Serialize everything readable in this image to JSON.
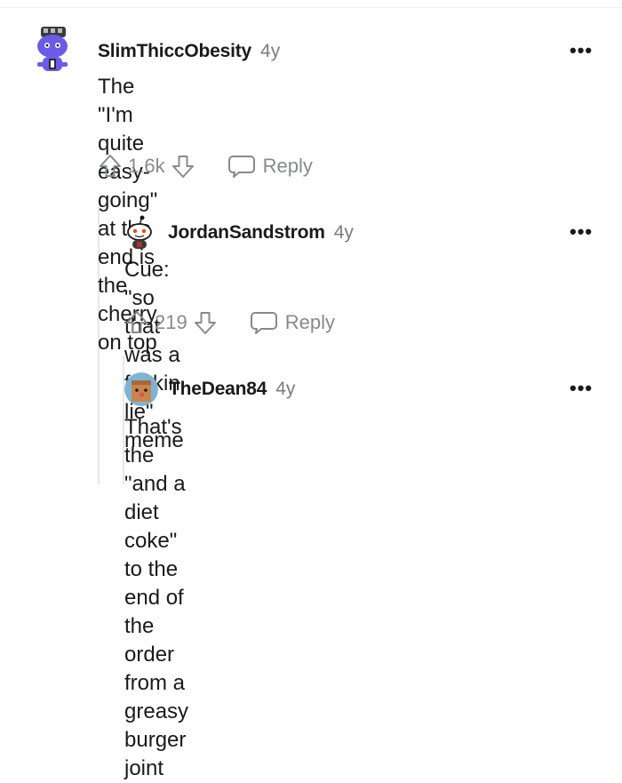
{
  "comments": [
    {
      "author": "SlimThiccObesity",
      "age": "4y",
      "text_lines": [
        "The \"I'm quite easy-going\" at the end is the",
        "cherry on top"
      ],
      "score": "1.6k",
      "reply_label": "Reply",
      "more_label": "•••"
    },
    {
      "author": "JordanSandstrom",
      "age": "4y",
      "text_lines": [
        "Cue: \"so that was a fuckin lie\" meme"
      ],
      "score": "219",
      "reply_label": "Reply",
      "more_label": "•••"
    },
    {
      "author": "TheDean84",
      "age": "4y",
      "text_lines": [
        "That's the \"and a diet coke\" to the end of the",
        "order from a greasy burger joint"
      ],
      "more_label": "•••"
    }
  ],
  "icons": {
    "upvote": "upvote-icon",
    "downvote": "downvote-icon",
    "reply": "speech-bubble-icon"
  },
  "colors": {
    "text": "#1a1a1b",
    "muted": "#878a8c",
    "thread_line": "#e6e8ea"
  }
}
